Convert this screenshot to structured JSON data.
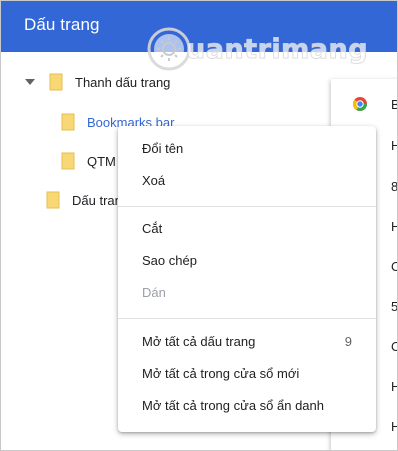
{
  "header": {
    "title": "Dấu trang"
  },
  "watermark": {
    "text": "uantrimang"
  },
  "tree": [
    {
      "label": "Thanh dấu trang",
      "expanded": true
    },
    {
      "label": "Bookmarks bar",
      "selected": true
    },
    {
      "label": "QTM"
    },
    {
      "label": "Dấu trang"
    }
  ],
  "panel": {
    "rows": [
      "B",
      "H",
      "8",
      "H",
      "O",
      "5",
      "O",
      "H",
      "H"
    ]
  },
  "context_menu": {
    "rename": "Đổi tên",
    "delete": "Xoá",
    "cut": "Cắt",
    "copy": "Sao chép",
    "paste": "Dán",
    "open_all": "Mở tất cả dấu trang",
    "open_all_count": "9",
    "open_all_new_window": "Mở tất cả trong cửa sổ mới",
    "open_all_incognito": "Mở tất cả trong cửa sổ ẩn danh"
  },
  "colors": {
    "header": "#3367d6",
    "folder": "#f8d775",
    "selected_text": "#3367d6",
    "disabled_text": "#9aa0a6"
  },
  "icons": {
    "folder": "folder-icon",
    "caret": "caret-down-icon",
    "favicon": "chrome-webstore-icon",
    "watermark_logo": "sun-logo-icon"
  }
}
